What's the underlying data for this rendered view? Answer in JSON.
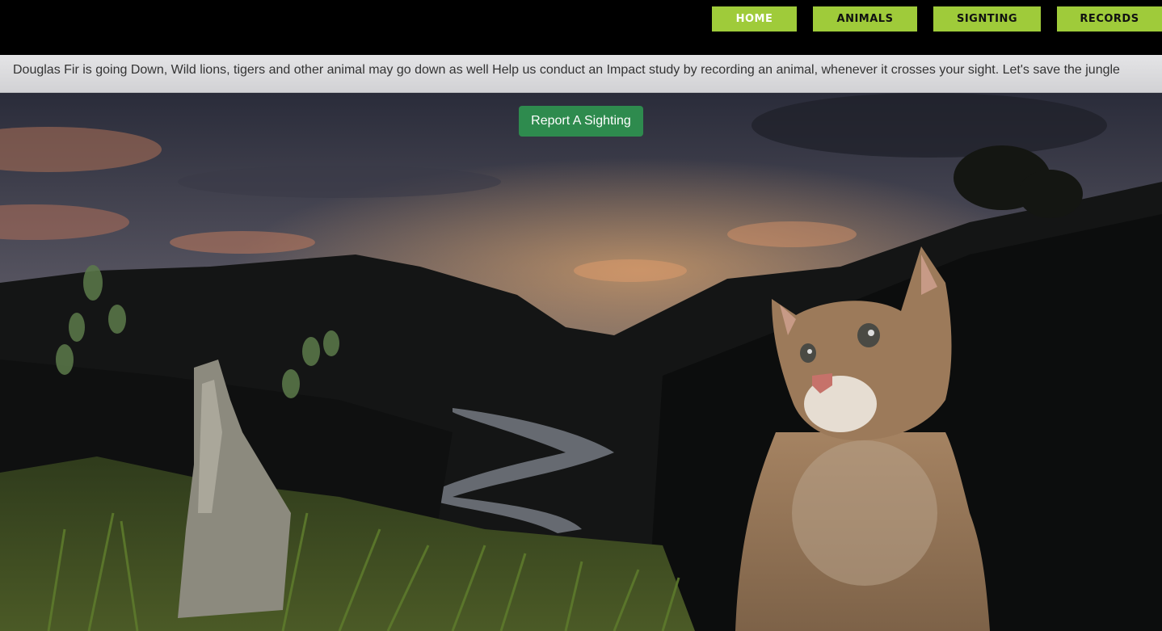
{
  "nav": {
    "items": [
      {
        "label": "HOME"
      },
      {
        "label": "ANIMALS"
      },
      {
        "label": "SIGNTING"
      },
      {
        "label": "RECORDS"
      }
    ],
    "accent_color": "#9fcb3a"
  },
  "banner": {
    "text": "Douglas Fir is going Down, Wild lions, tigers and other animal may go down as well Help us conduct an Impact study by recording an animal, whenever it crosses your sight. Let's save the jungle"
  },
  "cta": {
    "label": "Report A Sighting",
    "color": "#2e8b4e"
  }
}
